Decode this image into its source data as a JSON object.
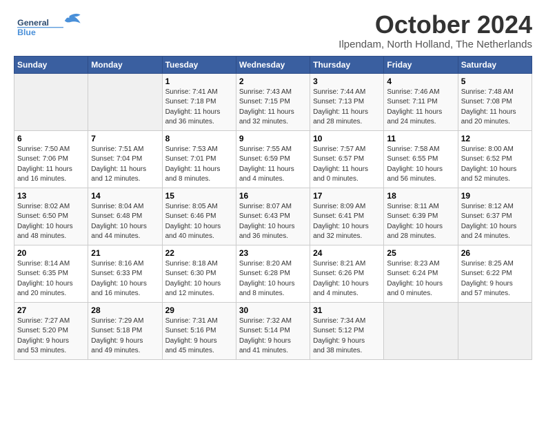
{
  "header": {
    "logo_line1": "General",
    "logo_line2": "Blue",
    "title": "October 2024",
    "subtitle": "Ilpendam, North Holland, The Netherlands"
  },
  "weekdays": [
    "Sunday",
    "Monday",
    "Tuesday",
    "Wednesday",
    "Thursday",
    "Friday",
    "Saturday"
  ],
  "weeks": [
    [
      {
        "num": "",
        "detail": ""
      },
      {
        "num": "",
        "detail": ""
      },
      {
        "num": "1",
        "detail": "Sunrise: 7:41 AM\nSunset: 7:18 PM\nDaylight: 11 hours\nand 36 minutes."
      },
      {
        "num": "2",
        "detail": "Sunrise: 7:43 AM\nSunset: 7:15 PM\nDaylight: 11 hours\nand 32 minutes."
      },
      {
        "num": "3",
        "detail": "Sunrise: 7:44 AM\nSunset: 7:13 PM\nDaylight: 11 hours\nand 28 minutes."
      },
      {
        "num": "4",
        "detail": "Sunrise: 7:46 AM\nSunset: 7:11 PM\nDaylight: 11 hours\nand 24 minutes."
      },
      {
        "num": "5",
        "detail": "Sunrise: 7:48 AM\nSunset: 7:08 PM\nDaylight: 11 hours\nand 20 minutes."
      }
    ],
    [
      {
        "num": "6",
        "detail": "Sunrise: 7:50 AM\nSunset: 7:06 PM\nDaylight: 11 hours\nand 16 minutes."
      },
      {
        "num": "7",
        "detail": "Sunrise: 7:51 AM\nSunset: 7:04 PM\nDaylight: 11 hours\nand 12 minutes."
      },
      {
        "num": "8",
        "detail": "Sunrise: 7:53 AM\nSunset: 7:01 PM\nDaylight: 11 hours\nand 8 minutes."
      },
      {
        "num": "9",
        "detail": "Sunrise: 7:55 AM\nSunset: 6:59 PM\nDaylight: 11 hours\nand 4 minutes."
      },
      {
        "num": "10",
        "detail": "Sunrise: 7:57 AM\nSunset: 6:57 PM\nDaylight: 11 hours\nand 0 minutes."
      },
      {
        "num": "11",
        "detail": "Sunrise: 7:58 AM\nSunset: 6:55 PM\nDaylight: 10 hours\nand 56 minutes."
      },
      {
        "num": "12",
        "detail": "Sunrise: 8:00 AM\nSunset: 6:52 PM\nDaylight: 10 hours\nand 52 minutes."
      }
    ],
    [
      {
        "num": "13",
        "detail": "Sunrise: 8:02 AM\nSunset: 6:50 PM\nDaylight: 10 hours\nand 48 minutes."
      },
      {
        "num": "14",
        "detail": "Sunrise: 8:04 AM\nSunset: 6:48 PM\nDaylight: 10 hours\nand 44 minutes."
      },
      {
        "num": "15",
        "detail": "Sunrise: 8:05 AM\nSunset: 6:46 PM\nDaylight: 10 hours\nand 40 minutes."
      },
      {
        "num": "16",
        "detail": "Sunrise: 8:07 AM\nSunset: 6:43 PM\nDaylight: 10 hours\nand 36 minutes."
      },
      {
        "num": "17",
        "detail": "Sunrise: 8:09 AM\nSunset: 6:41 PM\nDaylight: 10 hours\nand 32 minutes."
      },
      {
        "num": "18",
        "detail": "Sunrise: 8:11 AM\nSunset: 6:39 PM\nDaylight: 10 hours\nand 28 minutes."
      },
      {
        "num": "19",
        "detail": "Sunrise: 8:12 AM\nSunset: 6:37 PM\nDaylight: 10 hours\nand 24 minutes."
      }
    ],
    [
      {
        "num": "20",
        "detail": "Sunrise: 8:14 AM\nSunset: 6:35 PM\nDaylight: 10 hours\nand 20 minutes."
      },
      {
        "num": "21",
        "detail": "Sunrise: 8:16 AM\nSunset: 6:33 PM\nDaylight: 10 hours\nand 16 minutes."
      },
      {
        "num": "22",
        "detail": "Sunrise: 8:18 AM\nSunset: 6:30 PM\nDaylight: 10 hours\nand 12 minutes."
      },
      {
        "num": "23",
        "detail": "Sunrise: 8:20 AM\nSunset: 6:28 PM\nDaylight: 10 hours\nand 8 minutes."
      },
      {
        "num": "24",
        "detail": "Sunrise: 8:21 AM\nSunset: 6:26 PM\nDaylight: 10 hours\nand 4 minutes."
      },
      {
        "num": "25",
        "detail": "Sunrise: 8:23 AM\nSunset: 6:24 PM\nDaylight: 10 hours\nand 0 minutes."
      },
      {
        "num": "26",
        "detail": "Sunrise: 8:25 AM\nSunset: 6:22 PM\nDaylight: 9 hours\nand 57 minutes."
      }
    ],
    [
      {
        "num": "27",
        "detail": "Sunrise: 7:27 AM\nSunset: 5:20 PM\nDaylight: 9 hours\nand 53 minutes."
      },
      {
        "num": "28",
        "detail": "Sunrise: 7:29 AM\nSunset: 5:18 PM\nDaylight: 9 hours\nand 49 minutes."
      },
      {
        "num": "29",
        "detail": "Sunrise: 7:31 AM\nSunset: 5:16 PM\nDaylight: 9 hours\nand 45 minutes."
      },
      {
        "num": "30",
        "detail": "Sunrise: 7:32 AM\nSunset: 5:14 PM\nDaylight: 9 hours\nand 41 minutes."
      },
      {
        "num": "31",
        "detail": "Sunrise: 7:34 AM\nSunset: 5:12 PM\nDaylight: 9 hours\nand 38 minutes."
      },
      {
        "num": "",
        "detail": ""
      },
      {
        "num": "",
        "detail": ""
      }
    ]
  ]
}
